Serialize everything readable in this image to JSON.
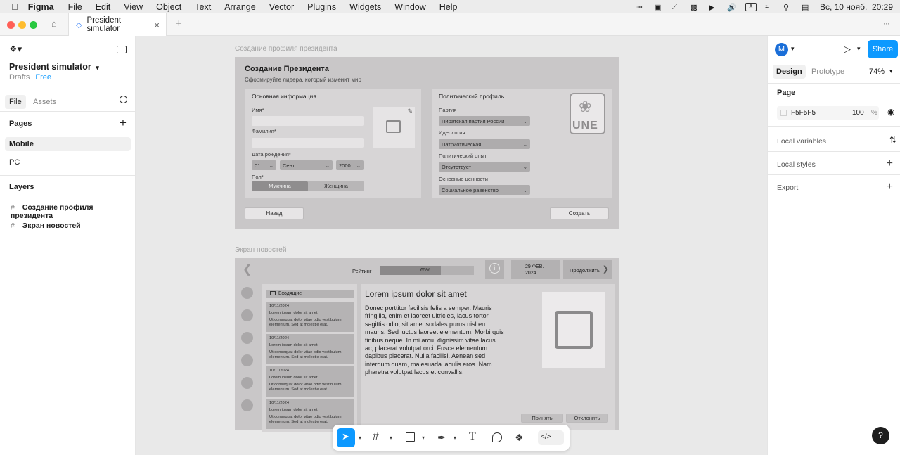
{
  "menubar": {
    "apple": "",
    "app": "Figma",
    "items": [
      "File",
      "Edit",
      "View",
      "Object",
      "Text",
      "Arrange",
      "Vector",
      "Plugins",
      "Widgets",
      "Window",
      "Help"
    ],
    "datetime": "Вс, 10 нояб.  20:29"
  },
  "tabs": {
    "active": "President simulator",
    "add": "+",
    "more": "···"
  },
  "left": {
    "file_title": "President simulator",
    "drafts": "Drafts",
    "plan": "Free",
    "tab_file": "File",
    "tab_assets": "Assets",
    "pages_heading": "Pages",
    "pages": [
      "Mobile",
      "PC"
    ],
    "layers_heading": "Layers",
    "layers": [
      "Создание профиля президента",
      "Экран новостей"
    ]
  },
  "canvas": {
    "frame1_label": "Создание профиля президента",
    "frame2_label": "Экран новостей",
    "form": {
      "title": "Создание Президента",
      "subtitle": "Сформируйте лидера, который изменит мир",
      "basic_heading": "Основная информация",
      "name_label": "Имя*",
      "surname_label": "Фамилия*",
      "dob_label": "Дата рождения*",
      "day": "01",
      "month": "Сент.",
      "year": "2000",
      "gender_label": "Пол*",
      "male": "Мужчина",
      "female": "Женщина",
      "political_heading": "Политический профиль",
      "party_label": "Партия",
      "party_value": "Пиратская партия России",
      "ideology_label": "Идеология",
      "ideology_value": "Патриотическая",
      "experience_label": "Политический опыт",
      "experience_value": "Отсутствует",
      "values_label": "Основные ценности",
      "values_value": "Социальное равенство",
      "logo_text": "UNE",
      "back_button": "Назад",
      "create_button": "Создать"
    },
    "news": {
      "rating_label": "Рейтинг",
      "rating_value": "65%",
      "rating_fraction": 0.65,
      "date": "29 ФЕВ. 2024",
      "continue_button": "Продолжить",
      "inbox_label": "Входящие",
      "items": [
        {
          "date": "10/11/2024",
          "title": "Lorem ipsum dolor sit amet",
          "body": "Ut consequat dolor vitae odio vestibulum elementum. Sed at molestie erat."
        },
        {
          "date": "10/11/2024",
          "title": "Lorem ipsum dolor sit amet",
          "body": "Ut consequat dolor vitae odio vestibulum elementum. Sed at molestie erat."
        },
        {
          "date": "10/11/2024",
          "title": "Lorem ipsum dolor sit amet",
          "body": "Ut consequat dolor vitae odio vestibulum elementum. Sed at molestie erat."
        },
        {
          "date": "10/11/2024",
          "title": "Lorem ipsum dolor sit amet",
          "body": "Ut consequat dolor vitae odio vestibulum elementum. Sed at molestie erat."
        }
      ],
      "article_title": "Lorem ipsum dolor sit amet",
      "article_body": "Donec porttitor facilisis felis a semper. Mauris fringilla, enim et laoreet ultricies, lacus tortor sagittis odio, sit amet sodales purus nisl eu mauris. Sed luctus laoreet elementum. Morbi quis finibus neque. In mi arcu, dignissim vitae lacus ac, placerat volutpat orci. Fusce elementum dapibus placerat. Nulla facilisi. Aenean sed interdum quam, malesuada iaculis eros. Nam pharetra volutpat lacus et convallis.",
      "accept_button": "Принять",
      "reject_button": "Отклонить"
    }
  },
  "right": {
    "avatar": "M",
    "share": "Share",
    "tab_design": "Design",
    "tab_prototype": "Prototype",
    "zoom": "74%",
    "page_heading": "Page",
    "page_color": "F5F5F5",
    "page_opacity": "100",
    "percent": "%",
    "local_variables": "Local variables",
    "local_styles": "Local styles",
    "export": "Export",
    "help": "?"
  },
  "colors": {
    "accent": "#0d99ff",
    "close": "#ff5f57",
    "minimize": "#febc2e",
    "zoom": "#28c840"
  }
}
